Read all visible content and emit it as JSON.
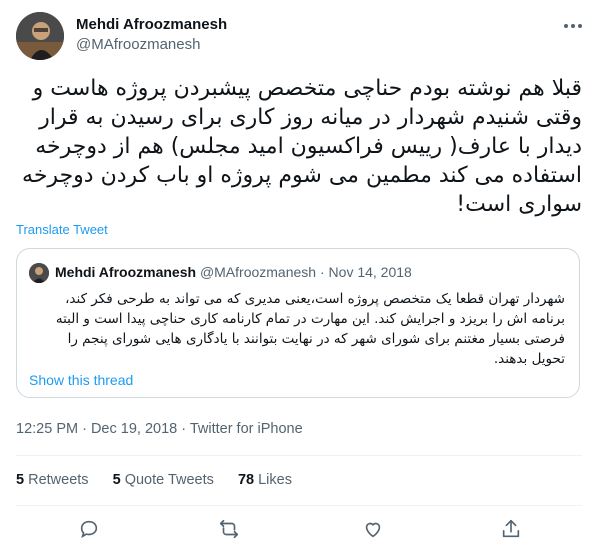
{
  "author": {
    "name": "Mehdi Afroozmanesh",
    "handle": "@MAfroozmanesh"
  },
  "tweet": {
    "text": "قبلا هم نوشته بودم حناچی متخصص پیشبردن پروژه هاست و وقتی شنیدم شهردار در میانه روز کاری برای رسیدن به قرار دیدار با عارف( رییس فراکسیون امید مجلس) هم از دوچرخه استفاده می کند مطمین می شوم پروژه او باب کردن دوچرخه سواری است!",
    "translate_label": "Translate Tweet"
  },
  "quoted_tweet": {
    "name": "Mehdi Afroozmanesh",
    "handle": "@MAfroozmanesh",
    "separator": " · ",
    "date": "Nov 14, 2018",
    "text": "شهردار تهران قطعا یک متخصص پروژه است،یعنی مدیری که می تواند به طرحی فکر کند، برنامه اش را بریزد و اجرایش کند. این مهارت در تمام کارنامه کاری حناچی پیدا است و البته فرصتی بسیار مغتنم برای شورای شهر که در نهایت بتوانند با یادگاری هایی شورای پنجم را تحویل بدهند.",
    "show_thread_label": "Show this thread"
  },
  "meta": {
    "timestamp": "12:25 PM · Dec 19, 2018 · Twitter for iPhone"
  },
  "stats": {
    "retweets_count": "5",
    "retweets_label": "Retweets",
    "quote_tweets_count": "5",
    "quote_tweets_label": "Quote Tweets",
    "likes_count": "78",
    "likes_label": "Likes"
  },
  "icons": {
    "more": "more-icon",
    "reply": "reply-icon",
    "retweet": "retweet-icon",
    "like": "heart-icon",
    "share": "share-icon"
  },
  "colors": {
    "link": "#1d9bf0",
    "muted": "#536471",
    "text": "#0f1419",
    "border": "#cfd9de"
  }
}
